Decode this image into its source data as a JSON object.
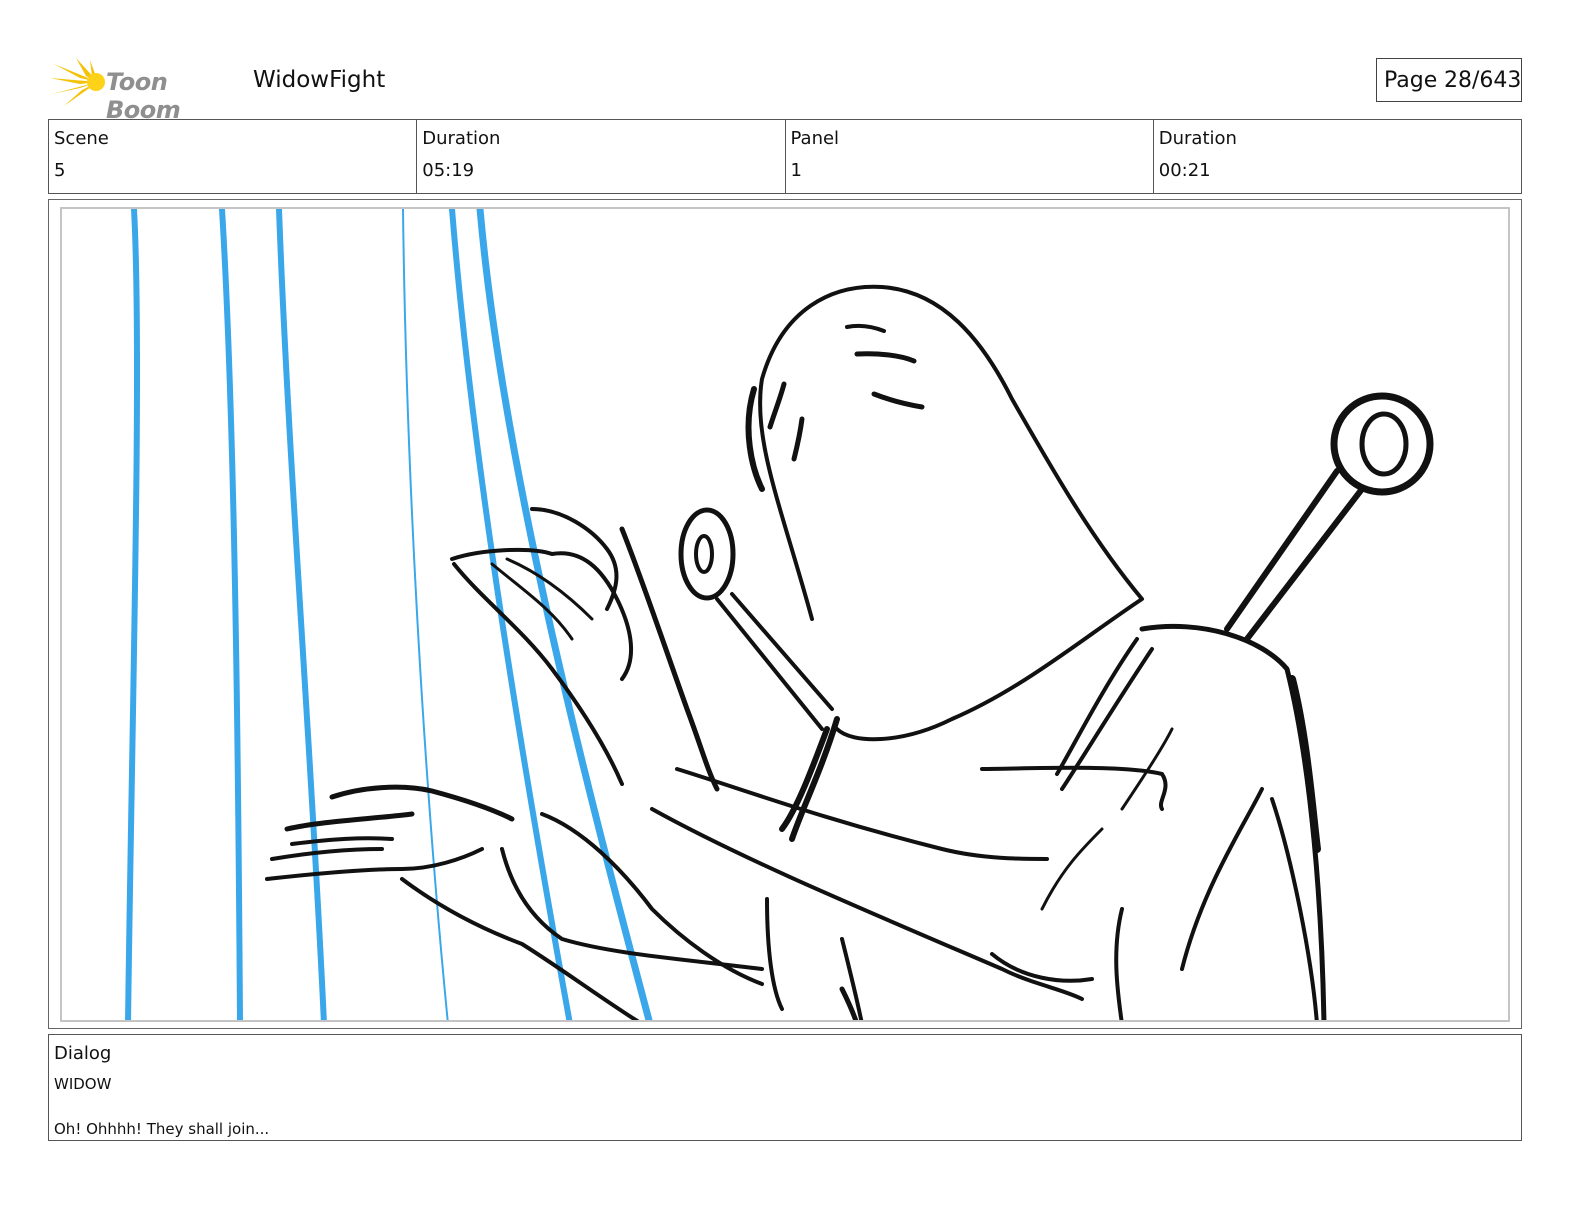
{
  "header": {
    "logo_text": "Toon Boom",
    "project_title": "WidowFight",
    "page_label": "Page",
    "page_number": "28/643"
  },
  "info": {
    "scene_label": "Scene",
    "scene_value": "5",
    "scene_duration_label": "Duration",
    "scene_duration_value": "05:19",
    "panel_label": "Panel",
    "panel_value": "1",
    "panel_duration_label": "Duration",
    "panel_duration_value": "00:21"
  },
  "dialog": {
    "label": "Dialog",
    "speaker": "WIDOW",
    "line": "Oh! Ohhhh! They shall join..."
  },
  "colors": {
    "logo_burst": "#f5c20a",
    "guide_lines": "#3aa7ea",
    "sketch": "#111111"
  },
  "icons": {
    "logo": "starburst-icon"
  }
}
